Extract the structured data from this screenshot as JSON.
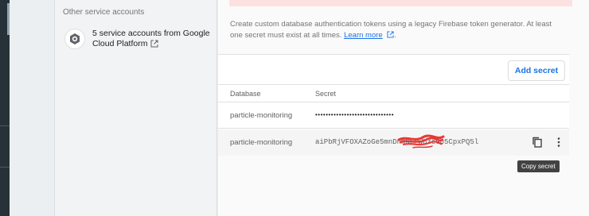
{
  "service_accounts": {
    "heading": "Other service accounts",
    "item_label": "5 service accounts from Google Cloud Platform",
    "item_icon": "gcp-logo-icon",
    "external_icon": "open-in-new-icon"
  },
  "database_secrets": {
    "description_text": "Create custom database authentication tokens using a legacy Firebase token generator. At least one secret must exist at all times.",
    "learn_more_label": "Learn more",
    "add_secret_label": "Add secret",
    "columns": {
      "database": "Database",
      "secret": "Secret"
    },
    "rows": [
      {
        "database": "particle-monitoring",
        "secret": "••••••••••••••••••••••••••••••",
        "masked": true
      },
      {
        "database": "particle-monitoring",
        "secret": "aiPbRjVFOXAZoGe5mnDnmNEPWbzsGb5CpxPQ5l",
        "masked": false
      }
    ],
    "copy_icon": "copy-icon",
    "more_icon": "more-vert-icon",
    "tooltip": "Copy secret"
  },
  "colors": {
    "accent": "#1a73e8",
    "redaction": "#e53935",
    "warning_strip": "#fde0e0"
  }
}
